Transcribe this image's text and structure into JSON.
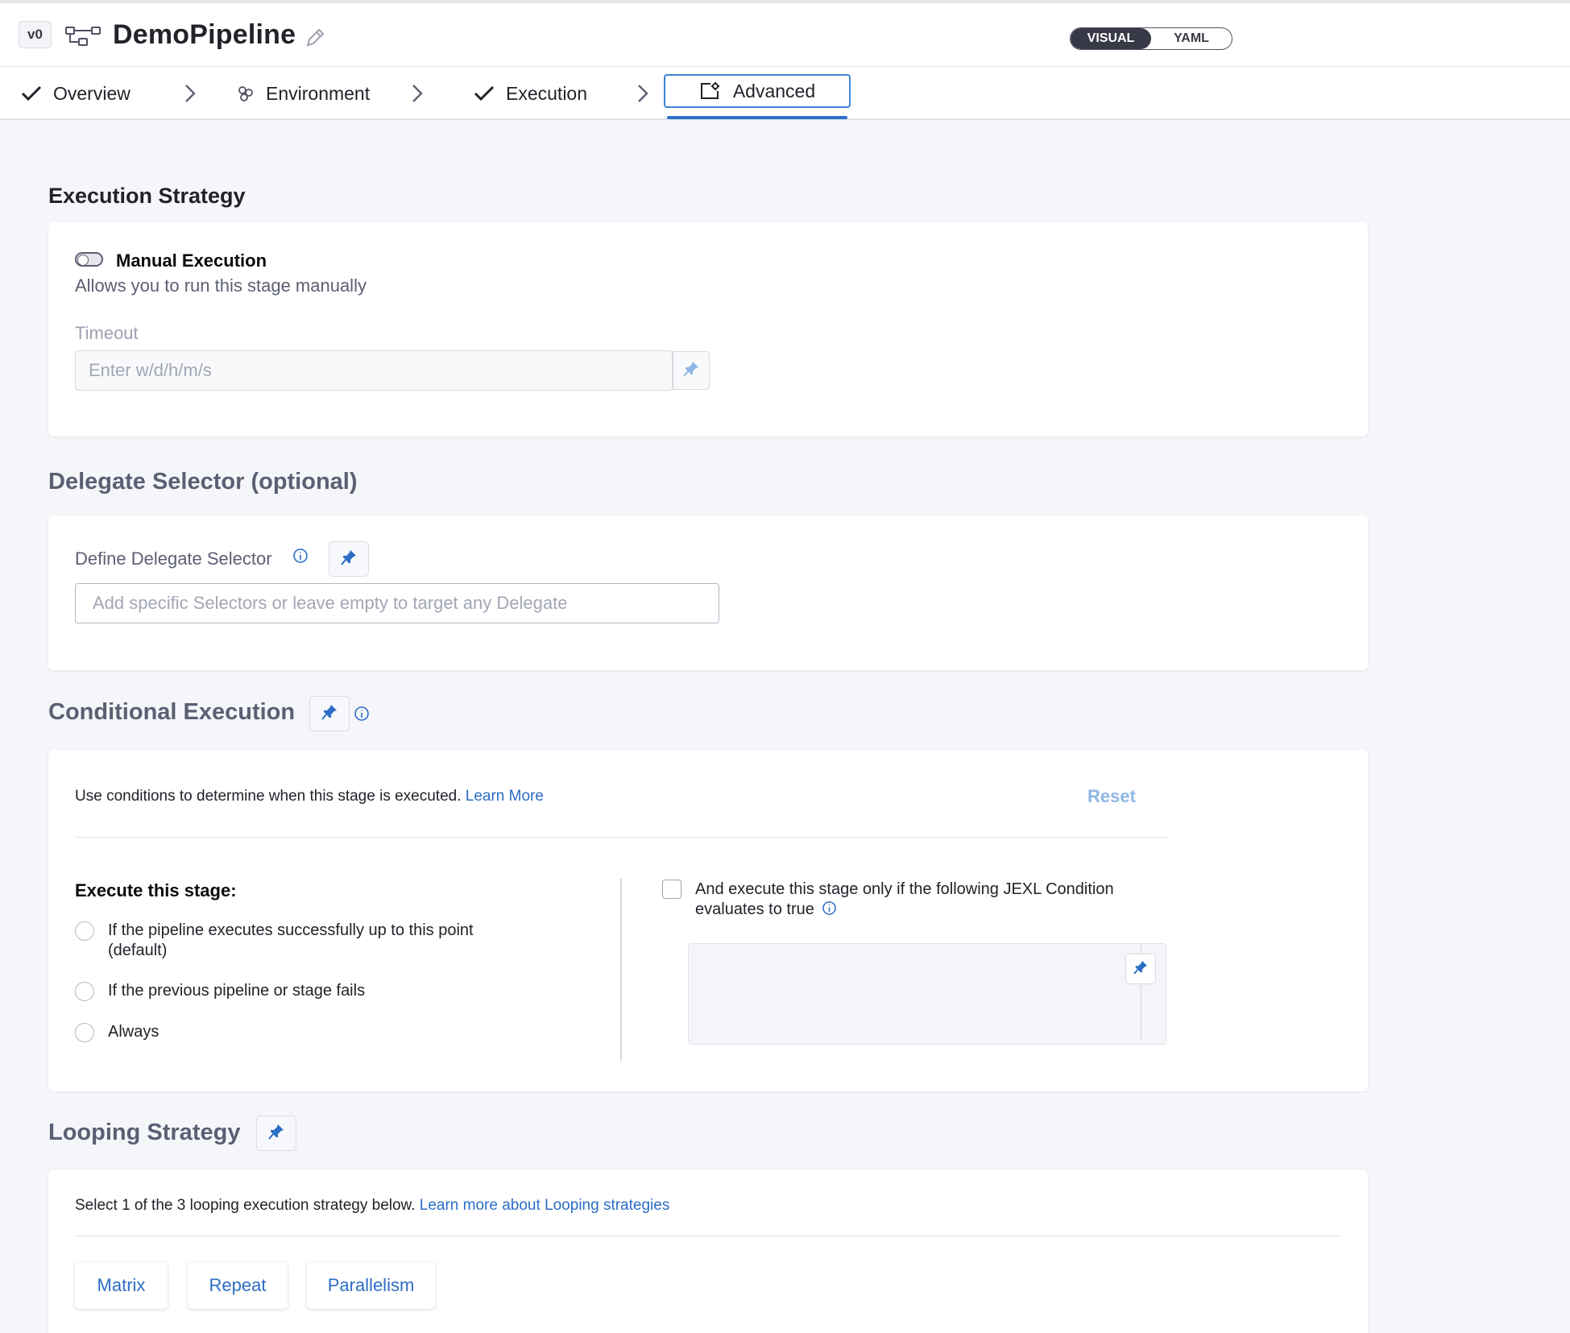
{
  "header": {
    "version": "v0",
    "pipeline_name": "DemoPipeline",
    "mode_visual": "VISUAL",
    "mode_yaml": "YAML"
  },
  "steps": [
    {
      "label": "Overview",
      "icon": "check-icon",
      "state": "done"
    },
    {
      "label": "Environment",
      "icon": "environment-icon",
      "state": "pending"
    },
    {
      "label": "Execution",
      "icon": "check-icon",
      "state": "done"
    },
    {
      "label": "Advanced",
      "icon": "advanced-icon",
      "state": "active"
    }
  ],
  "execution_strategy": {
    "title": "Execution Strategy",
    "manual_label": "Manual Execution",
    "manual_desc": "Allows you to run this stage manually",
    "timeout_label": "Timeout",
    "timeout_placeholder": "Enter w/d/h/m/s",
    "manual_enabled": false
  },
  "delegate": {
    "title": "Delegate Selector (optional)",
    "label": "Define Delegate Selector",
    "placeholder": "Add specific Selectors or leave empty to target any Delegate"
  },
  "conditional": {
    "title": "Conditional Execution",
    "intro": "Use conditions to determine when this stage is executed.",
    "learn_more": "Learn More",
    "reset": "Reset",
    "execute_heading": "Execute this stage:",
    "options": [
      {
        "line1": "If the pipeline executes successfully up to this point",
        "line2": "(default)"
      },
      {
        "line1": "If the previous pipeline or stage fails",
        "line2": ""
      },
      {
        "line1": "Always",
        "line2": ""
      }
    ],
    "jexl_line1": "And execute this stage only if the following JEXL Condition",
    "jexl_line2": "evaluates to true"
  },
  "looping": {
    "title": "Looping Strategy",
    "intro": "Select 1 of the 3 looping execution strategy below.",
    "learn_more": "Learn more about Looping strategies",
    "buttons": [
      "Matrix",
      "Repeat",
      "Parallelism"
    ]
  },
  "colors": {
    "accent": "#2b6dc4",
    "active_tab_border": "#3c84d6",
    "background": "#f5f6fa"
  }
}
